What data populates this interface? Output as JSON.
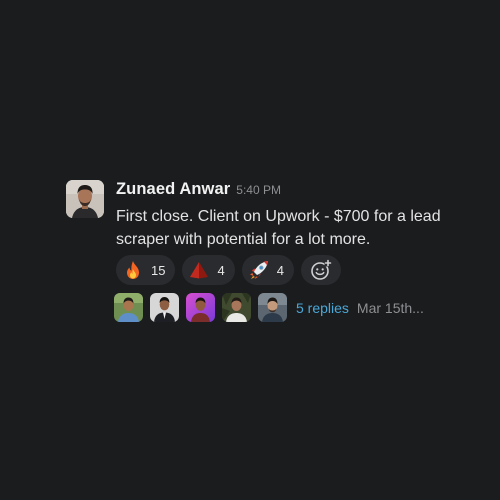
{
  "message": {
    "author": "Zunaed Anwar",
    "time": "5:40 PM",
    "text": "First close. Client on Upwork - $700 for a lead scraper with potential for a lot more."
  },
  "reactions": [
    {
      "icon": "fire-emoji",
      "count": "15"
    },
    {
      "icon": "red-pyramid-emoji",
      "count": "4"
    },
    {
      "icon": "rocket-emoji",
      "count": "4"
    }
  ],
  "thread": {
    "replies_label": "5 replies",
    "last_reply": "Mar 15th..."
  },
  "colors": {
    "background": "#1b1c1e",
    "pill": "#2a2b2e",
    "link": "#4aa8d8",
    "muted": "#8e8f92"
  }
}
